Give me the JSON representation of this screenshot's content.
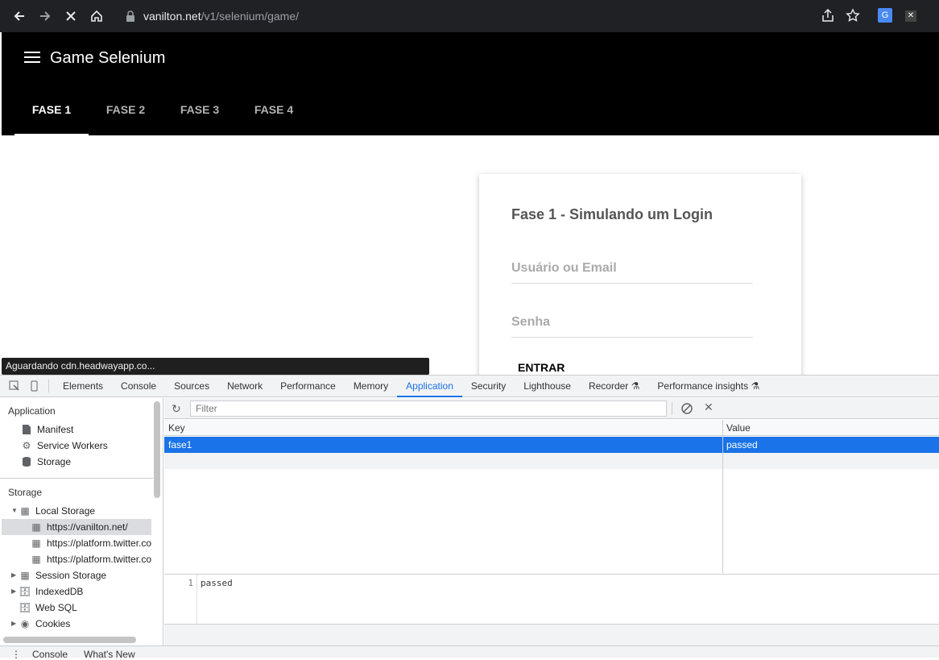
{
  "browser": {
    "url_host": "vanilton.net",
    "url_path": "/v1/selenium/game/"
  },
  "app": {
    "title": "Game Selenium",
    "tabs": [
      {
        "label": "FASE 1",
        "active": true
      },
      {
        "label": "FASE 2",
        "active": false
      },
      {
        "label": "FASE 3",
        "active": false
      },
      {
        "label": "FASE 4",
        "active": false
      }
    ]
  },
  "login_card": {
    "title": "Fase 1 - Simulando um Login",
    "user_placeholder": "Usuário ou Email",
    "password_placeholder": "Senha",
    "submit_label": "ENTRAR"
  },
  "status_tooltip": "Aguardando cdn.headwayapp.co...",
  "devtools": {
    "tabs": [
      "Elements",
      "Console",
      "Sources",
      "Network",
      "Performance",
      "Memory",
      "Application",
      "Security",
      "Lighthouse",
      "Recorder ⚗",
      "Performance insights ⚗"
    ],
    "active_tab": "Application",
    "sidebar": {
      "application_header": "Application",
      "application_items": [
        "Manifest",
        "Service Workers",
        "Storage"
      ],
      "storage_header": "Storage",
      "local_storage": "Local Storage",
      "local_storage_items": [
        "https://vanilton.net/",
        "https://platform.twitter.co",
        "https://platform.twitter.co"
      ],
      "other_items": [
        "Session Storage",
        "IndexedDB",
        "Web SQL",
        "Cookies"
      ]
    },
    "filter_placeholder": "Filter",
    "table": {
      "key_header": "Key",
      "value_header": "Value",
      "rows": [
        {
          "key": "fase1",
          "value": "passed"
        }
      ]
    },
    "preview": {
      "line": "1",
      "text": "passed"
    },
    "drawer_tabs": [
      "Console",
      "What's New"
    ]
  }
}
